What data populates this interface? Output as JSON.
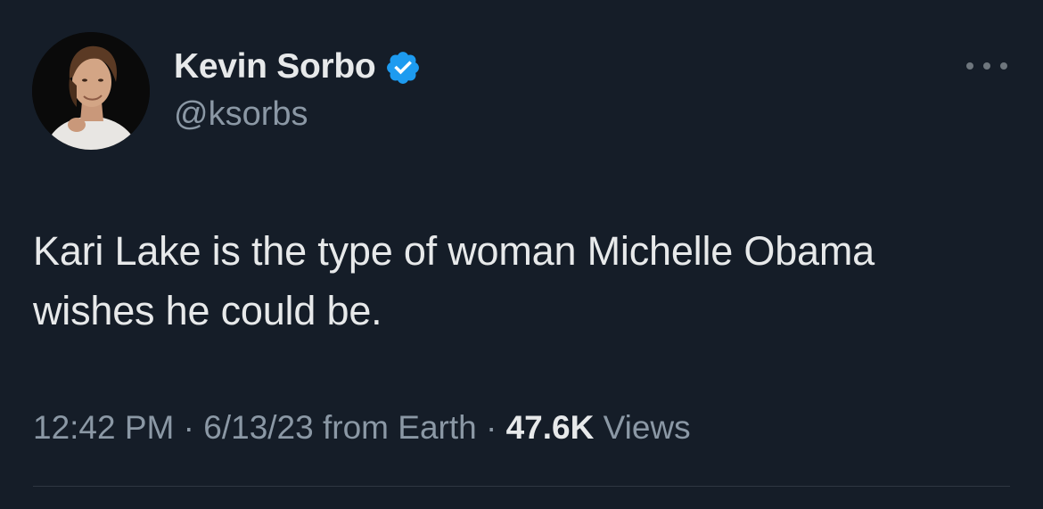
{
  "author": {
    "display_name": "Kevin Sorbo",
    "handle": "@ksorbs",
    "verified": true,
    "verified_color": "#1d9bf0"
  },
  "tweet": {
    "text_line1": "Kari Lake is the type of woman Michelle Obama",
    "text_line2": "wishes he could be."
  },
  "meta": {
    "time": "12:42 PM",
    "separator1": " · ",
    "date": "6/13/23",
    "source": " from Earth",
    "separator2": " · ",
    "views_count": "47.6K",
    "views_label": " Views"
  },
  "icons": {
    "more": "more-horizontal-icon",
    "verified": "verified-badge-icon"
  }
}
